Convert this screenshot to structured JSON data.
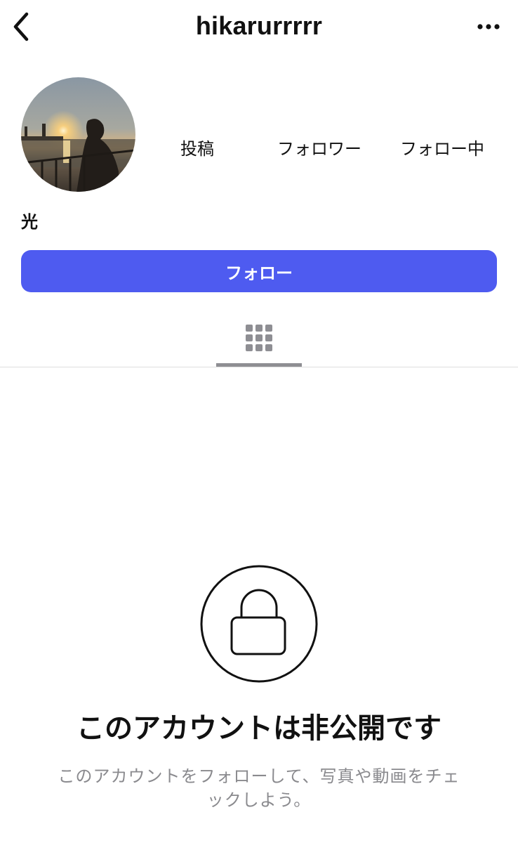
{
  "header": {
    "username": "hikarurrrrr"
  },
  "stats": {
    "posts_label": "投稿",
    "followers_label": "フォロワー",
    "following_label": "フォロー中"
  },
  "profile": {
    "display_name": "光"
  },
  "actions": {
    "follow_label": "フォロー"
  },
  "private_notice": {
    "title": "このアカウントは非公開です",
    "description": "このアカウントをフォローして、写真や動画をチェックしよう。"
  },
  "icons": {
    "back": "chevron-left-icon",
    "more": "more-horizontal-icon",
    "grid": "grid-icon",
    "lock": "lock-icon"
  },
  "colors": {
    "accent": "#4e5bf0",
    "text": "#111111",
    "muted": "#8a8a8e",
    "tab_indicator": "#8e8e93"
  }
}
